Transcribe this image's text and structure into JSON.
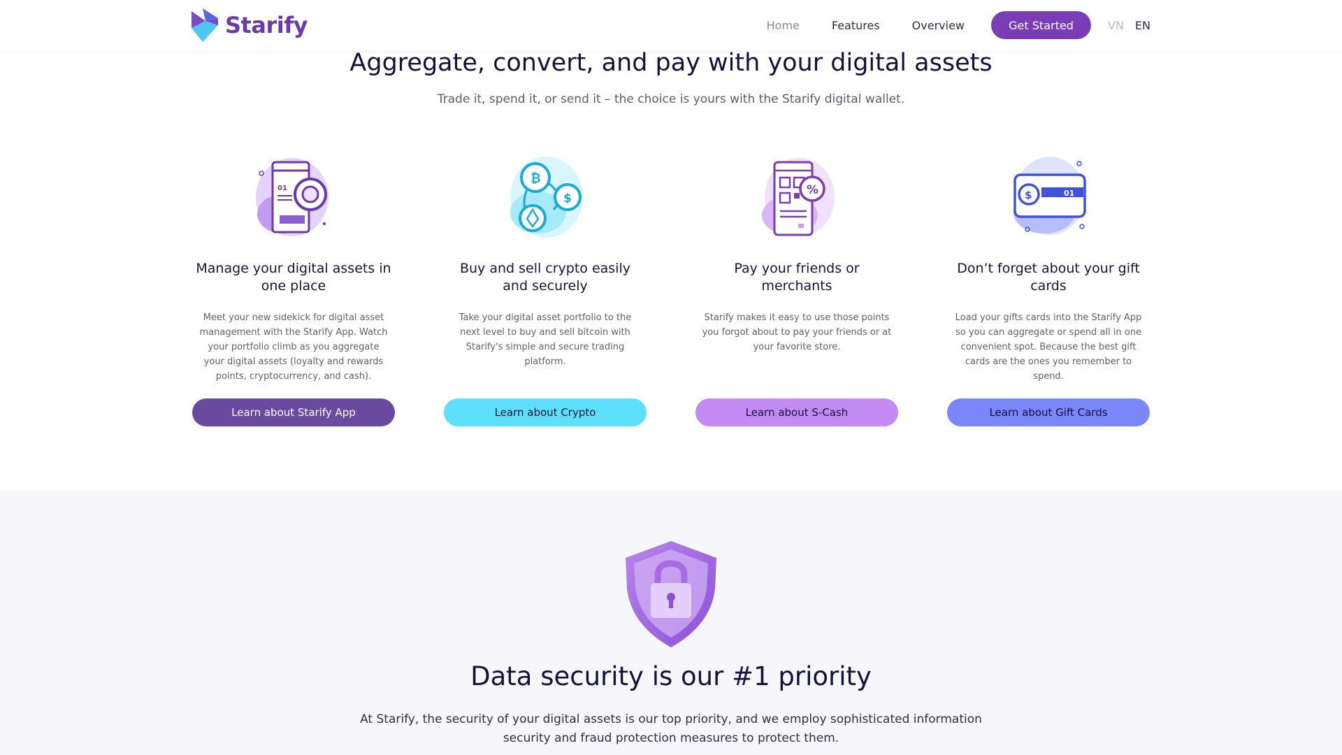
{
  "brand": {
    "name": "Starify",
    "primary": "#7b3cb8"
  },
  "nav": {
    "items": [
      "Home",
      "Features",
      "Overview"
    ],
    "cta": "Get Started",
    "lang_vn": "VN",
    "lang_en": "EN"
  },
  "hero": {
    "title": "Aggregate, convert, and pay with your digital assets",
    "subtitle": "Trade it, spend it, or send it – the choice is yours with the Starify digital wallet."
  },
  "features": [
    {
      "icon": "phone-chart-icon",
      "title": "Manage your digital assets in one place",
      "description": "Meet your new sidekick for digital asset management with the Starify App. Watch your portfolio climb as you aggregate your digital assets (loyalty and rewards points, cryptocurrency, and cash).",
      "button": "Learn about Starify App",
      "color": "#6a4a9e"
    },
    {
      "icon": "crypto-coins-icon",
      "title": "Buy and sell crypto easily and securely",
      "description": "Take your digital asset portfolio to the next level to buy and sell bitcoin with Starify's simple and secure trading platform.",
      "button": "Learn about Crypto",
      "color": "#5de0fb"
    },
    {
      "icon": "qr-phone-icon",
      "title": "Pay your friends or merchants",
      "description": "Starify makes it easy to use those points you forgot about to pay your friends or at your favorite store.",
      "button": "Learn about S-Cash",
      "color": "#c38af2"
    },
    {
      "icon": "gift-card-icon",
      "title": "Don’t forget about your gift cards",
      "description": "Load your gifts cards into the Starify App so you can aggregate or spend all in one convenient spot. Because the best gift cards are the ones you remember to spend.",
      "button": "Learn about Gift Cards",
      "color": "#7a86fa"
    }
  ],
  "security": {
    "title": "Data security is our #1 priority",
    "text": "At Starify, the security of your digital assets is our top priority, and we employ sophisticated information security and fraud protection measures to protect them."
  }
}
